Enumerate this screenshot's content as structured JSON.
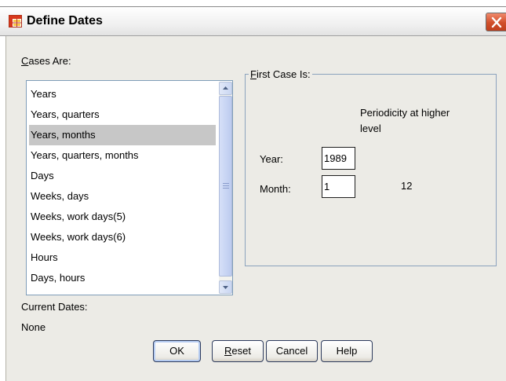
{
  "window": {
    "title": "Define Dates",
    "icon": "grid-table-icon",
    "close_icon": "close-x-icon"
  },
  "cases_are": {
    "label_accel": "C",
    "label_rest": "ases Are:",
    "items": [
      "Years",
      "Years, quarters",
      "Years, months",
      "Years, quarters, months",
      "Days",
      "Weeks, days",
      "Weeks, work days(5)",
      "Weeks, work days(6)",
      "Hours",
      "Days, hours"
    ],
    "selected": "Years, months"
  },
  "current_dates": {
    "label": "Current Dates:",
    "value": "None"
  },
  "first_case": {
    "legend_accel": "F",
    "legend_rest": "irst Case Is:",
    "periodicity_line1": "Periodicity at higher",
    "periodicity_line2": "level",
    "year_label": "Year:",
    "year_value": "1989",
    "month_label": "Month:",
    "month_value": "1",
    "month_periodicity": "12"
  },
  "buttons": {
    "ok": "OK",
    "reset_accel": "R",
    "reset_rest": "eset",
    "cancel": "Cancel",
    "help": "Help"
  },
  "colors": {
    "selection": "#c7c7c7",
    "client_bg": "#ecebe6",
    "close_button": "#d14f2b"
  }
}
